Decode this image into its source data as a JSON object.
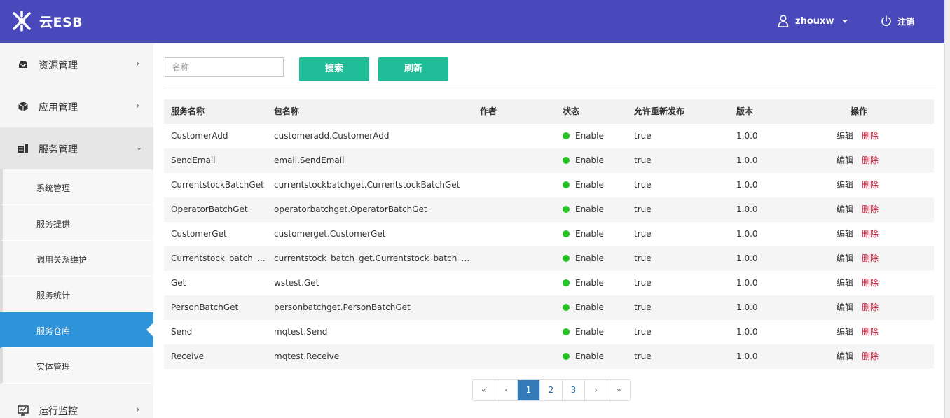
{
  "header": {
    "brand": "云ESB",
    "username": "zhouxw",
    "logout_label": "注销"
  },
  "sidebar": {
    "items": [
      {
        "label": "资源管理",
        "icon": "inbox-icon"
      },
      {
        "label": "应用管理",
        "icon": "cube-icon"
      },
      {
        "label": "服务管理",
        "icon": "services-icon",
        "expanded": true
      },
      {
        "label": "运行监控",
        "icon": "monitor-icon"
      }
    ],
    "sub_items": [
      {
        "label": "系统管理"
      },
      {
        "label": "服务提供"
      },
      {
        "label": "调用关系维护"
      },
      {
        "label": "服务统计"
      },
      {
        "label": "服务仓库",
        "active": true
      },
      {
        "label": "实体管理"
      }
    ]
  },
  "toolbar": {
    "search_placeholder": "名称",
    "search_label": "搜索",
    "refresh_label": "刷新"
  },
  "table": {
    "columns": [
      "服务名称",
      "包名称",
      "作者",
      "状态",
      "允许重新发布",
      "版本",
      "操作"
    ],
    "rows": [
      {
        "name": "CustomerAdd",
        "package": "customeradd.CustomerAdd",
        "author": "",
        "status": "Enable",
        "republish": "true",
        "version": "1.0.0"
      },
      {
        "name": "SendEmail",
        "package": "email.SendEmail",
        "author": "",
        "status": "Enable",
        "republish": "true",
        "version": "1.0.0"
      },
      {
        "name": "CurrentstockBatchGet",
        "package": "currentstockbatchget.CurrentstockBatchGet",
        "author": "",
        "status": "Enable",
        "republish": "true",
        "version": "1.0.0"
      },
      {
        "name": "OperatorBatchGet",
        "package": "operatorbatchget.OperatorBatchGet",
        "author": "",
        "status": "Enable",
        "republish": "true",
        "version": "1.0.0"
      },
      {
        "name": "CustomerGet",
        "package": "customerget.CustomerGet",
        "author": "",
        "status": "Enable",
        "republish": "true",
        "version": "1.0.0"
      },
      {
        "name": "Currentstock_batch_g...",
        "package": "currentstock_batch_get.Currentstock_batch_get",
        "author": "",
        "status": "Enable",
        "republish": "true",
        "version": "1.0.0"
      },
      {
        "name": "Get",
        "package": "wstest.Get",
        "author": "",
        "status": "Enable",
        "republish": "true",
        "version": "1.0.0"
      },
      {
        "name": "PersonBatchGet",
        "package": "personbatchget.PersonBatchGet",
        "author": "",
        "status": "Enable",
        "republish": "true",
        "version": "1.0.0"
      },
      {
        "name": "Send",
        "package": "mqtest.Send",
        "author": "",
        "status": "Enable",
        "republish": "true",
        "version": "1.0.0"
      },
      {
        "name": "Receive",
        "package": "mqtest.Receive",
        "author": "",
        "status": "Enable",
        "republish": "true",
        "version": "1.0.0"
      }
    ],
    "edit_label": "编辑",
    "delete_label": "删除"
  },
  "pagination": {
    "first": "«",
    "prev": "‹",
    "pages": [
      "1",
      "2",
      "3"
    ],
    "current": "1",
    "next": "›",
    "last": "»"
  },
  "colors": {
    "header_bg": "#4a49bb",
    "button_bg": "#1fbc98",
    "active_nav_bg": "#2e93d9",
    "status_enabled": "#22c322",
    "delete_text": "#c8102e",
    "pager_current": "#337ab7"
  }
}
